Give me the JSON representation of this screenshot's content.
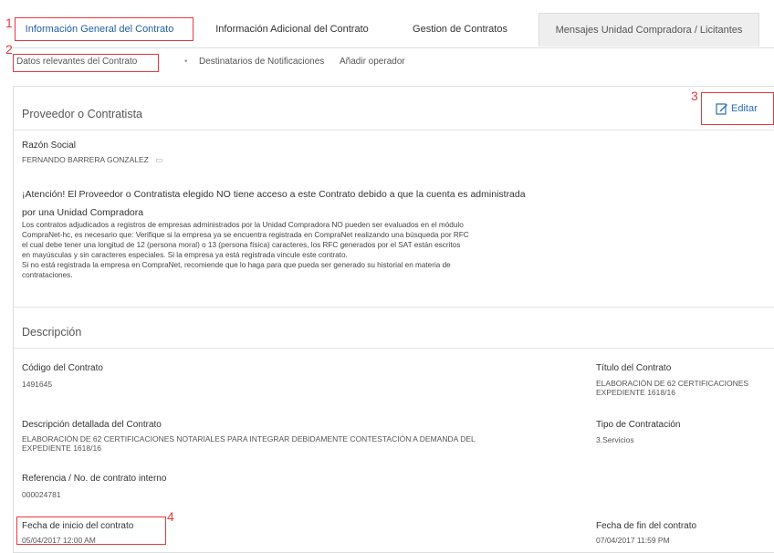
{
  "tabs": [
    {
      "label": "Información General del Contrato"
    },
    {
      "label": "Información Adicional del Contrato"
    },
    {
      "label": "Gestion de Contratos"
    },
    {
      "label": "Mensajes Unidad Compradora / Licitantes"
    }
  ],
  "subnav": [
    {
      "label": "Datos relevantes del Contrato"
    },
    {
      "label": "Destinatarios de Notificaciones"
    },
    {
      "label": "Añadir operador"
    }
  ],
  "markers": [
    "1",
    "2",
    "3",
    "4"
  ],
  "edit_button": {
    "label": "Editar",
    "icon": "edit-icon"
  },
  "proveedor": {
    "title": "Proveedor o Contratista",
    "razon_label": "Razón Social",
    "razon_value": "FERNANDO BARRERA GONZALEZ",
    "warning": "¡Atención! El Proveedor o Contratista elegido NO tiene acceso a este Contrato debido a que la cuenta es administrada por una Unidad Compradora",
    "body_lines": [
      "Los contratos adjudicados a registros de empresas administrados por la Unidad Compradora NO pueden ser evaluados en el módulo",
      "CompraNet-hc, es necesario que: Verifique si la empresa ya se encuentra registrada en CompraNet realizando una búsqueda por RFC",
      "el cual debe tener una longitud de 12 (persona moral) o 13 (persona física) caracteres, los RFC generados por el SAT están escritos",
      "en mayúsculas y sin caracteres especiales. Si la empresa ya está registrada vincule este contrato.",
      "Si no está registrada la empresa en CompraNet, recomiende que lo haga para que pueda ser generado su historial en materia de",
      "contrataciones."
    ]
  },
  "descripcion": {
    "title": "Descripción",
    "codigo_label": "Código del Contrato",
    "codigo_value": "1491645",
    "titulo_label": "Título del Contrato",
    "titulo_lines": [
      "ELABORACIÓN DE 62 CERTIFICACIONES",
      "EXPEDIENTE 1618/16"
    ],
    "desc_label": "Descripción detallada del Contrato",
    "desc_lines": [
      "ELABORACIÓN DE 62 CERTIFICACIONES NOTARIALES PARA INTEGRAR DEBIDAMENTE CONTESTACIÓN A DEMANDA DEL",
      "EXPEDIENTE 1618/16"
    ],
    "tipo_label": "Tipo de Contratación",
    "tipo_value": "3.Servicios",
    "ref_label": "Referencia / No. de contrato interno",
    "ref_value": "000024781",
    "inicio_label": "Fecha de inicio del contrato",
    "inicio_value": "05/04/2017 12:00 AM",
    "fin_label": "Fecha de fin del contrato",
    "fin_value": "07/04/2017 11:59 PM"
  },
  "colors": {
    "accent": "#2c6db5",
    "highlight": "#e8383d"
  }
}
